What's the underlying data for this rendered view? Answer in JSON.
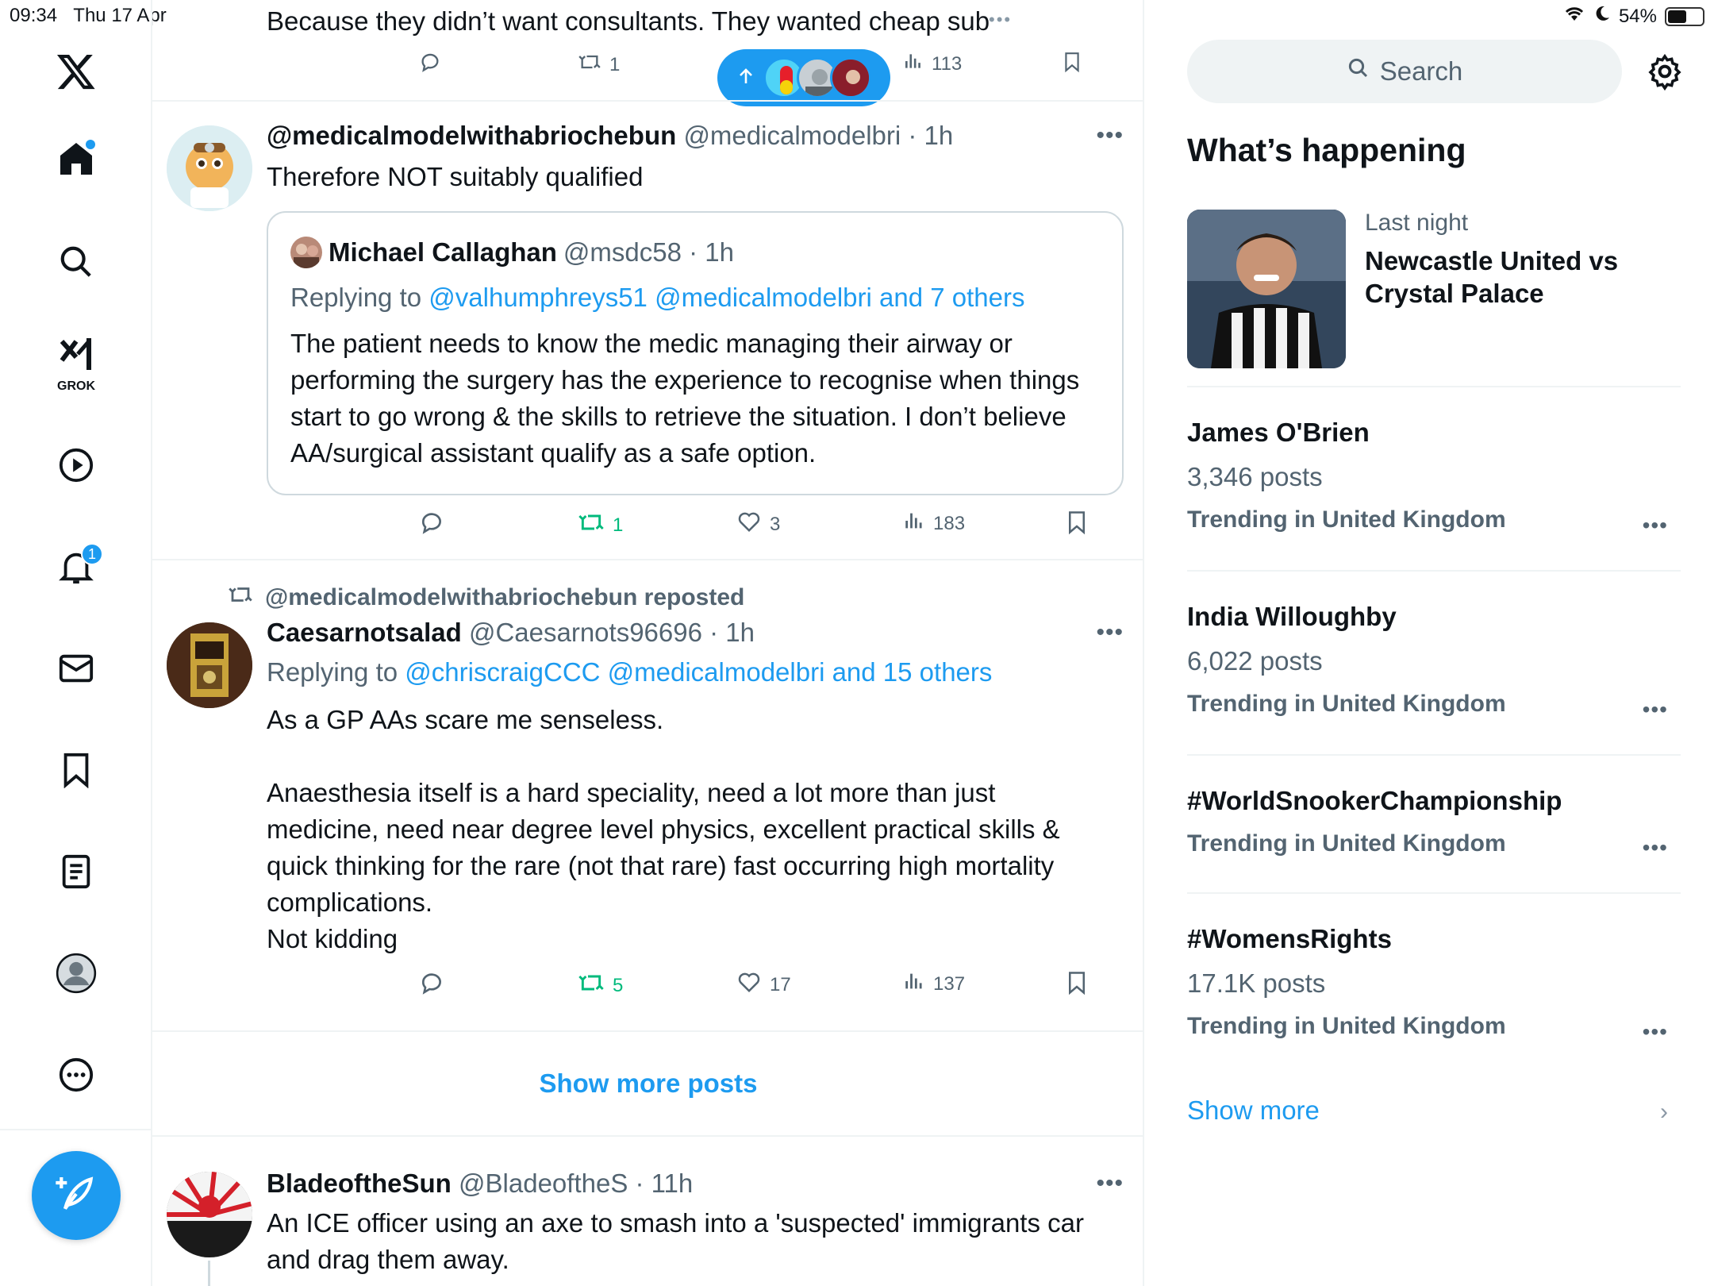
{
  "status_bar": {
    "time": "09:34",
    "date": "Thu 17 Apr",
    "battery": "54%",
    "battery_level": 0.54
  },
  "nav": {
    "items": [
      {
        "name": "x-logo",
        "icon": "x-logo-icon"
      },
      {
        "name": "home",
        "icon": "home-icon"
      },
      {
        "name": "explore",
        "icon": "search-icon"
      },
      {
        "name": "grok",
        "icon": "grok-icon",
        "label": "GROK"
      },
      {
        "name": "video",
        "icon": "play-icon"
      },
      {
        "name": "notifications",
        "icon": "bell-icon",
        "badge": "1"
      },
      {
        "name": "messages",
        "icon": "mail-icon"
      },
      {
        "name": "bookmarks",
        "icon": "bookmark-icon"
      },
      {
        "name": "lists",
        "icon": "list-icon"
      },
      {
        "name": "profile",
        "icon": "avatar-icon"
      },
      {
        "name": "more",
        "icon": "more-circle-icon"
      }
    ],
    "compose_icon": "compose-feather-icon"
  },
  "feed": {
    "top_tweet": {
      "text": "Because they didn’t want consultants. They wanted  cheap sub",
      "retweets": "1",
      "views": "113"
    },
    "new_posts_pill": {
      "icon": "arrow-up-icon"
    },
    "tweet1": {
      "name": "@medicalmodelwithabriochebun",
      "handle": "@medicalmodelbri · 1h",
      "text": "Therefore NOT suitably qualified",
      "quote": {
        "name": "Michael Callaghan",
        "handle": "@msdc58 · 1h",
        "reply_prefix": "Replying to",
        "reply_targets": "@valhumphreys51 @medicalmodelbri and 7 others",
        "text": "The patient needs to know the medic managing their airway or performing the surgery has the experience to recognise when things start to go wrong & the skills to retrieve the situation. I don’t believe AA/surgical assistant qualify as a safe option."
      },
      "retweets": "1",
      "likes": "3",
      "views": "183"
    },
    "tweet2": {
      "repost_label": "@medicalmodelwithabriochebun reposted",
      "name": "Caesarnotsalad",
      "handle": "@Caesarnots96696 · 1h",
      "reply_prefix": "Replying to",
      "reply_targets": "@chriscraigCCC @medicalmodelbri and 15 others",
      "text_line1": "As a GP AAs scare me senseless.",
      "text_para2": "Anaesthesia itself is a hard speciality, need a lot more than just medicine, need near degree level physics, excellent practical skills & quick thinking for the rare (not that rare) fast occurring high mortality complications.",
      "text_line3": "Not kidding",
      "retweets": "5",
      "likes": "17",
      "views": "137"
    },
    "show_more_posts": "Show more posts",
    "tweet3": {
      "name": "BladeoftheSun",
      "handle": "@BladeoftheS · 11h",
      "text": "An ICE officer using an axe to smash into a 'suspected' immigrants car and drag them away."
    }
  },
  "sidebar": {
    "search_placeholder": "Search",
    "whats_happening": "What’s happening",
    "news": {
      "context": "Last night",
      "title": "Newcastle United vs Crystal Palace"
    },
    "trends": [
      {
        "name": "James O'Brien",
        "count": "3,346 posts",
        "context": "Trending in United Kingdom"
      },
      {
        "name": "India Willoughby",
        "count": "6,022 posts",
        "context": "Trending in United Kingdom"
      },
      {
        "name": "#WorldSnookerChampionship",
        "count": "",
        "context": "Trending in United Kingdom"
      },
      {
        "name": "#WomensRights",
        "count": "17.1K posts",
        "context": "Trending in United Kingdom"
      }
    ],
    "show_more": "Show more"
  },
  "colors": {
    "accent": "#1d9bf0",
    "text": "#0f1419",
    "secondary": "#536471",
    "retweet_green": "#00ba7c",
    "border": "#eff3f4"
  }
}
